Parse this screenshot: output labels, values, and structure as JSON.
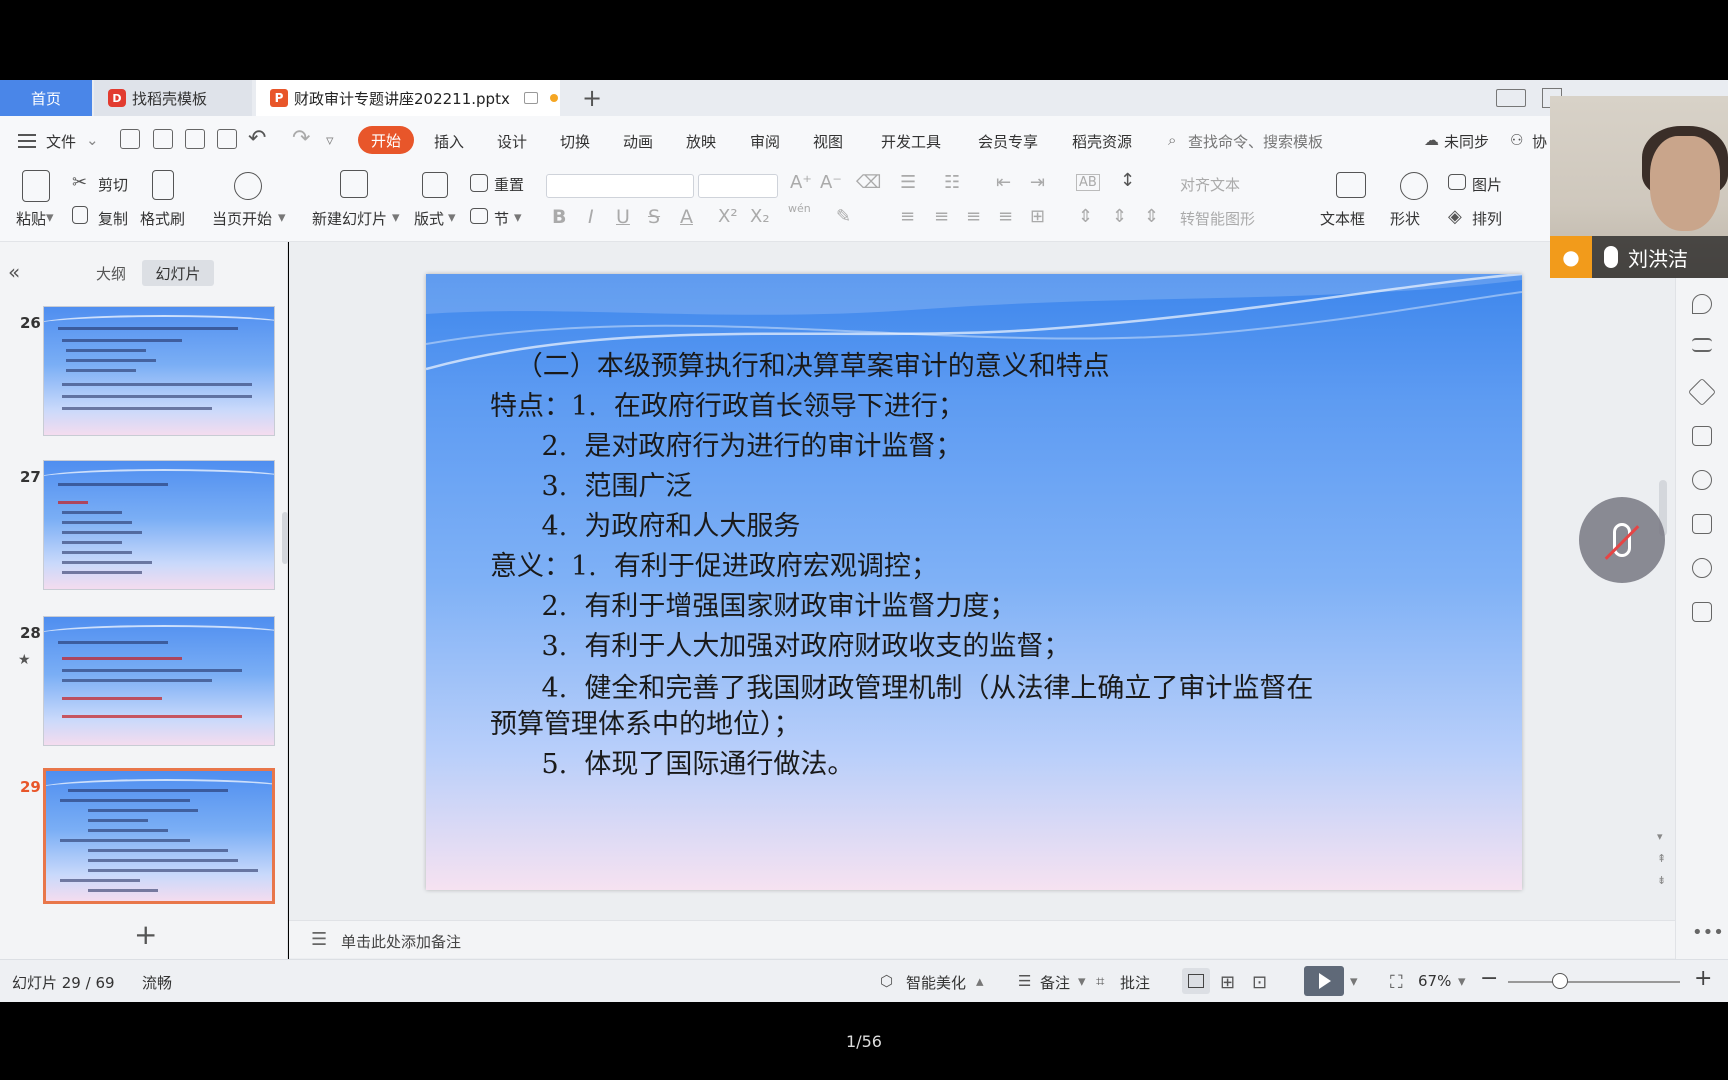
{
  "tabs": {
    "home": "首页",
    "template": "找稻壳模板",
    "document": "财政审计专题讲座202211.pptx",
    "template_logo": "D",
    "document_logo": "P"
  },
  "menu": {
    "file": "文件",
    "items": [
      "开始",
      "插入",
      "设计",
      "切换",
      "动画",
      "放映",
      "审阅",
      "视图",
      "开发工具",
      "会员专享",
      "稻壳资源"
    ],
    "search_placeholder": "查找命令、搜索模板",
    "sync": "未同步",
    "collab": "协"
  },
  "ribbon": {
    "paste": "粘贴",
    "cut": "剪切",
    "copy": "复制",
    "format_painter": "格式刷",
    "start_from_current": "当页开始",
    "new_slide": "新建幻灯片",
    "layout": "版式",
    "reset": "重置",
    "section": "节",
    "bold": "B",
    "italic": "I",
    "underline": "U",
    "strike": "S",
    "font_color": "A",
    "superscript": "X²",
    "subscript": "X₂",
    "phonetic": "wén",
    "align_text": "对齐文本",
    "smart_shape": "转智能图形",
    "text_box": "文本框",
    "shape": "形状",
    "picture": "图片",
    "arrange": "排列"
  },
  "left_panel": {
    "tab_outline": "大纲",
    "tab_slides": "幻灯片",
    "slides": [
      {
        "number": "26"
      },
      {
        "number": "27"
      },
      {
        "number": "28"
      },
      {
        "number": "29"
      }
    ],
    "add_label": "+",
    "collapse": "«"
  },
  "slide": {
    "lines": [
      "   （二）本级预算执行和决算草案审计的意义和特点",
      "特点：1.  在政府行政首长领导下进行；",
      "      2.  是对政府行为进行的审计监督；",
      "      3.  范围广泛",
      "      4.  为政府和人大服务",
      "意义：1.  有利于促进政府宏观调控；",
      "      2.  有利于增强国家财政审计监督力度；",
      "      3.  有利于人大加强对政府财政收支的监督；",
      "      4.  健全和完善了我国财政管理机制（从法律上确立了审计监督在",
      "预算管理体系中的地位）；",
      "      5.  体现了国际通行做法。"
    ]
  },
  "notes": {
    "placeholder": "单击此处添加备注"
  },
  "status": {
    "slide_counter": "幻灯片 29 / 69",
    "theme": "流畅",
    "beautify": "智能美化",
    "notes": "备注",
    "comments": "批注",
    "zoom": "67%"
  },
  "video": {
    "name": "刘洪洁"
  },
  "pager": "1/56"
}
